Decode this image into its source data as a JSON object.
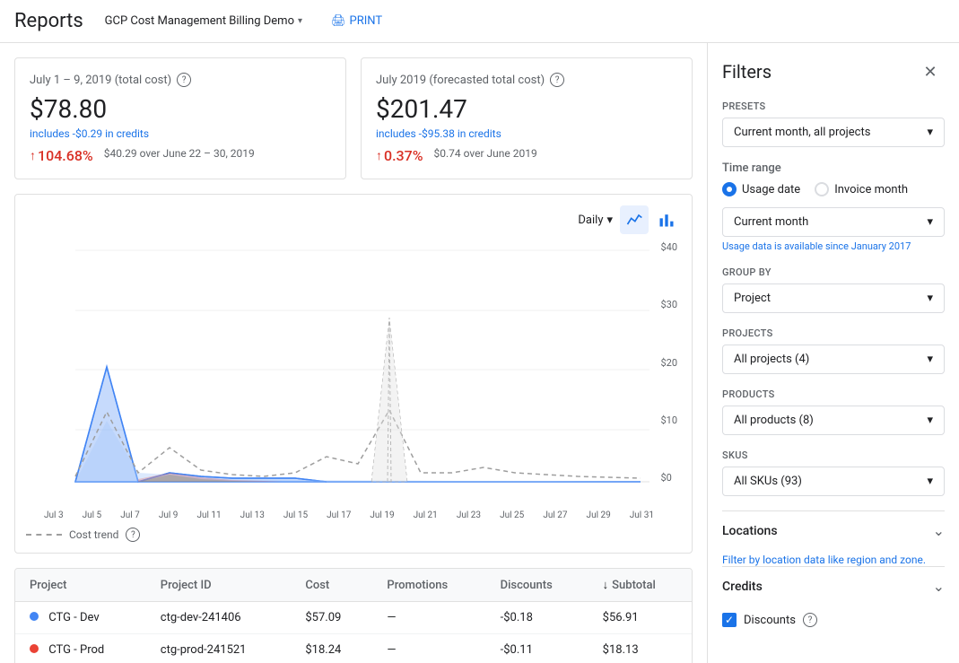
{
  "header": {
    "title": "Reports",
    "project": "GCP Cost Management Billing Demo",
    "print_label": "PRINT"
  },
  "summary": {
    "card1": {
      "title": "July 1 – 9, 2019 (total cost)",
      "cost": "$78.80",
      "credit": "includes -$0.29 in credits",
      "change_pct": "104.68%",
      "change_desc": "$40.29 over June 22 – 30, 2019"
    },
    "card2": {
      "title": "July 2019 (forecasted total cost)",
      "cost": "$201.47",
      "credit": "includes -$95.38 in credits",
      "change_pct": "0.37%",
      "change_desc": "$0.74 over June 2019"
    }
  },
  "chart": {
    "granularity": "Daily",
    "y_labels": [
      "$40",
      "$30",
      "$20",
      "$10",
      "$0"
    ],
    "x_labels": [
      "Jul 3",
      "Jul 5",
      "Jul 7",
      "Jul 9",
      "Jul 11",
      "Jul 13",
      "Jul 15",
      "Jul 17",
      "Jul 19",
      "Jul 21",
      "Jul 23",
      "Jul 25",
      "Jul 27",
      "Jul 29",
      "Jul 31"
    ],
    "legend": "Cost trend"
  },
  "table": {
    "headers": [
      "Project",
      "Project ID",
      "Cost",
      "Promotions",
      "Discounts",
      "Subtotal"
    ],
    "rows": [
      {
        "dot": "blue",
        "project": "CTG - Dev",
        "project_id": "ctg-dev-241406",
        "cost": "$57.09",
        "promotions": "—",
        "discounts": "-$0.18",
        "subtotal": "$56.91"
      },
      {
        "dot": "red",
        "project": "CTG - Prod",
        "project_id": "ctg-prod-241521",
        "cost": "$18.24",
        "promotions": "—",
        "discounts": "-$0.11",
        "subtotal": "$18.13"
      }
    ]
  },
  "filters": {
    "title": "Filters",
    "presets_label": "Presets",
    "presets_value": "Current month, all projects",
    "time_range_label": "Time range",
    "usage_date_label": "Usage date",
    "invoice_month_label": "Invoice month",
    "current_month_label": "Current month",
    "usage_note": "Usage data is available since January 2017",
    "group_by_label": "Group by",
    "group_by_value": "Project",
    "projects_label": "Projects",
    "projects_value": "All projects (4)",
    "products_label": "Products",
    "products_value": "All products (8)",
    "skus_label": "SKUs",
    "skus_value": "All SKUs (93)",
    "locations_label": "Locations",
    "locations_link": "Filter by location data like region and zone.",
    "credits_label": "Credits",
    "discounts_label": "Discounts"
  }
}
